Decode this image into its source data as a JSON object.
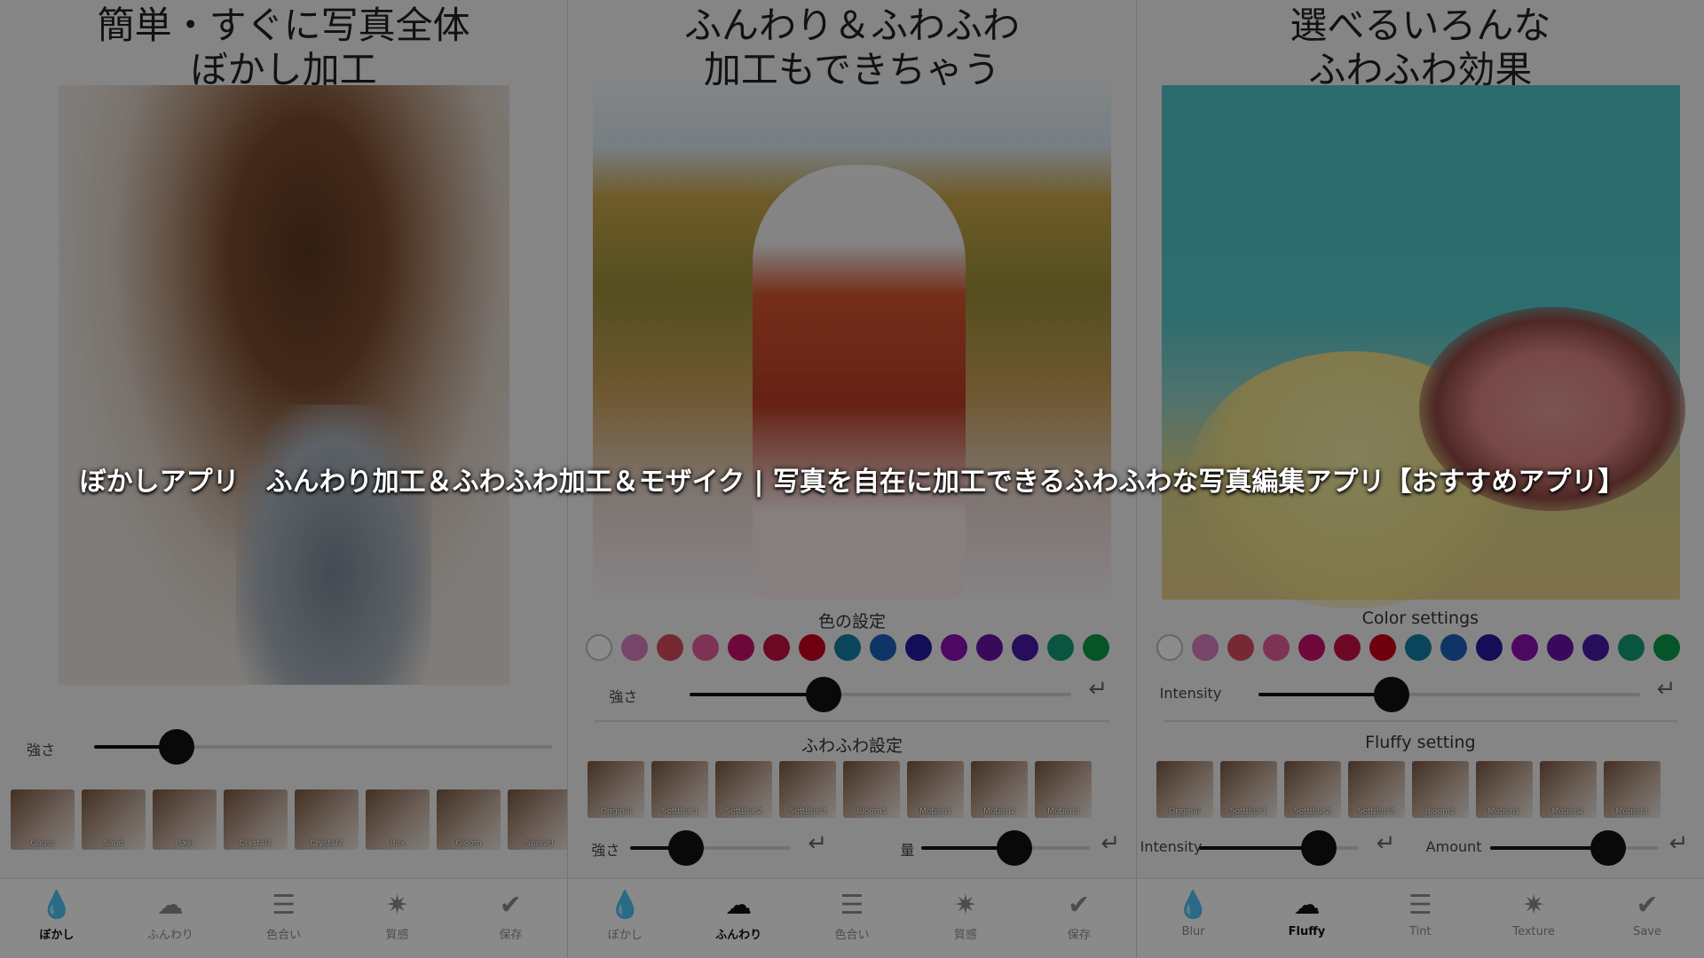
{
  "caption": "ぼかしアプリ　ふんわり加工＆ふわふわ加工＆モザイク | 写真を自在に加工できるふわふわな写真編集アプリ【おすすめアプリ】",
  "panel1": {
    "headline": [
      "簡単・すぐに写真全体",
      "ぼかし加工"
    ],
    "intensity_label": "強さ",
    "intensity_value": 0.18,
    "filters": [
      "Gauss",
      "Sand",
      "Pixel",
      "Crystal1",
      "Crystal2",
      "Box",
      "Gloom",
      "Spread"
    ],
    "tabs": [
      {
        "icon": "drop-icon",
        "glyph": "💧",
        "label": "ぼかし",
        "active": true
      },
      {
        "icon": "cloud-icon",
        "glyph": "☁",
        "label": "ふんわり",
        "active": false
      },
      {
        "icon": "sliders-icon",
        "glyph": "☰",
        "label": "色合い",
        "active": false
      },
      {
        "icon": "star-burst-icon",
        "glyph": "✷",
        "label": "質感",
        "active": false
      },
      {
        "icon": "check-icon",
        "glyph": "✔",
        "label": "保存",
        "active": false
      }
    ]
  },
  "panel2": {
    "headline": [
      "ふんわり＆ふわふわ",
      "加工もできちゃう"
    ],
    "color_settings_title": "色の設定",
    "intensity_label": "強さ",
    "intensity_value": 0.35,
    "fluffy_title": "ふわふわ設定",
    "fluffy_filters": [
      "Original",
      "SoftBlur1",
      "SoftBlur2",
      "SoftBlur3",
      "Bloom1",
      "Motion1",
      "Motion2",
      "Motion3"
    ],
    "fluffy_intensity_label": "強さ",
    "fluffy_intensity_value": 0.35,
    "amount_label": "量",
    "amount_value": 0.55,
    "tabs": [
      {
        "icon": "drop-icon",
        "glyph": "💧",
        "label": "ぼかし",
        "active": false
      },
      {
        "icon": "cloud-icon",
        "glyph": "☁",
        "label": "ふんわり",
        "active": true
      },
      {
        "icon": "sliders-icon",
        "glyph": "☰",
        "label": "色合い",
        "active": false
      },
      {
        "icon": "star-burst-icon",
        "glyph": "✷",
        "label": "質感",
        "active": false
      },
      {
        "icon": "check-icon",
        "glyph": "✔",
        "label": "保存",
        "active": false
      }
    ]
  },
  "panel3": {
    "headline": [
      "選べるいろんな",
      "ふわふわ効果"
    ],
    "color_settings_title": "Color settings",
    "intensity_label": "Intensity",
    "intensity_value": 0.35,
    "fluffy_title": "Fluffy setting",
    "fluffy_filters": [
      "Original",
      "SoftBlur1",
      "SoftBlur2",
      "SoftBlur3",
      "Bloom1",
      "Motion1",
      "Motion2",
      "Motion3"
    ],
    "fluffy_intensity_label": "Intensity",
    "fluffy_intensity_value": 0.75,
    "amount_label": "Amount",
    "amount_value": 0.7,
    "tabs": [
      {
        "icon": "drop-icon",
        "glyph": "💧",
        "label": "Blur",
        "active": false
      },
      {
        "icon": "cloud-icon",
        "glyph": "☁",
        "label": "Fluffy",
        "active": true
      },
      {
        "icon": "sliders-icon",
        "glyph": "☰",
        "label": "Tint",
        "active": false
      },
      {
        "icon": "star-burst-icon",
        "glyph": "✷",
        "label": "Texture",
        "active": false
      },
      {
        "icon": "check-icon",
        "glyph": "✔",
        "label": "Save",
        "active": false
      }
    ]
  },
  "swatch_colors": [
    "#ffffff",
    "#d77fbf",
    "#d84b5d",
    "#e45d9c",
    "#c8106c",
    "#c60f43",
    "#c8001e",
    "#137ea8",
    "#1a62b8",
    "#231a9e",
    "#8c10b3",
    "#6812a8",
    "#4a18a8",
    "#139979",
    "#0d9a4a"
  ],
  "reset_glyph": "↵"
}
